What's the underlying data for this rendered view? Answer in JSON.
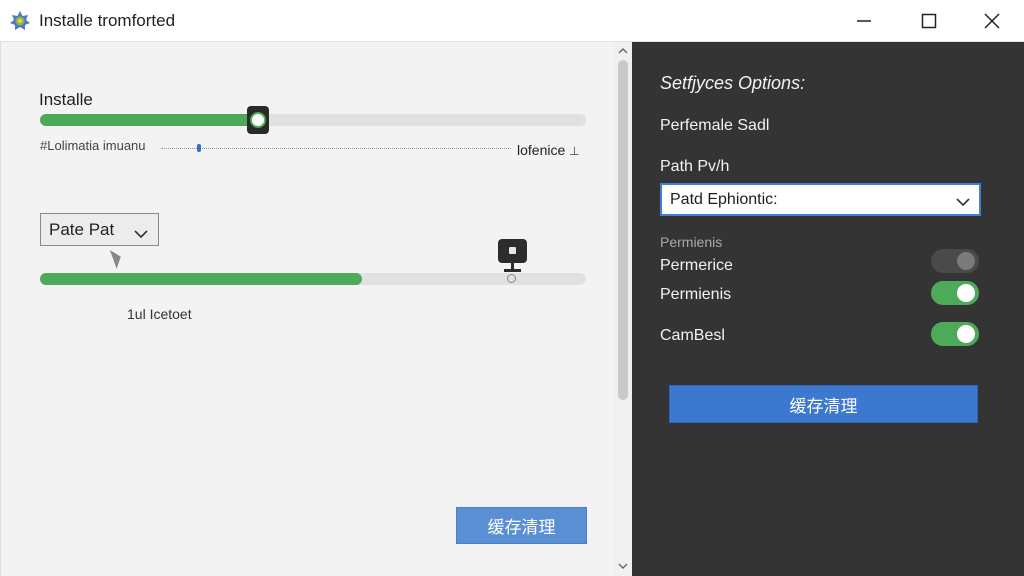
{
  "window": {
    "title": "Installe tromforted",
    "minimize_icon": "minimize-icon",
    "maximize_icon": "maximize-icon",
    "close_icon": "close-icon"
  },
  "left_panel": {
    "section_title": "Installe",
    "slider1": {
      "value_fraction": 0.4,
      "left_label": "#Lolimatia imuanu",
      "right_label": "lofenice"
    },
    "dropdown": {
      "selected": "Pate Pat"
    },
    "slider2": {
      "value_fraction": 0.59,
      "label": "1ul Icetoet"
    },
    "action_button": "缓存清理"
  },
  "right_panel": {
    "title": "Setfjyces Options:",
    "field1_label": "Perfemale Sadl",
    "path_label": "Path Pv/h",
    "path_select": {
      "selected": "Patd Ephiontic:"
    },
    "group_label": "Permienis",
    "toggles": [
      {
        "label": "Permerice",
        "state": "off"
      },
      {
        "label": "Permienis",
        "state": "on"
      },
      {
        "label": "CamBesl",
        "state": "on"
      }
    ],
    "action_button": "缓存清理"
  },
  "colors": {
    "accent_green": "#4caa58",
    "accent_blue": "#3d78cf",
    "dark_panel": "#343434"
  }
}
